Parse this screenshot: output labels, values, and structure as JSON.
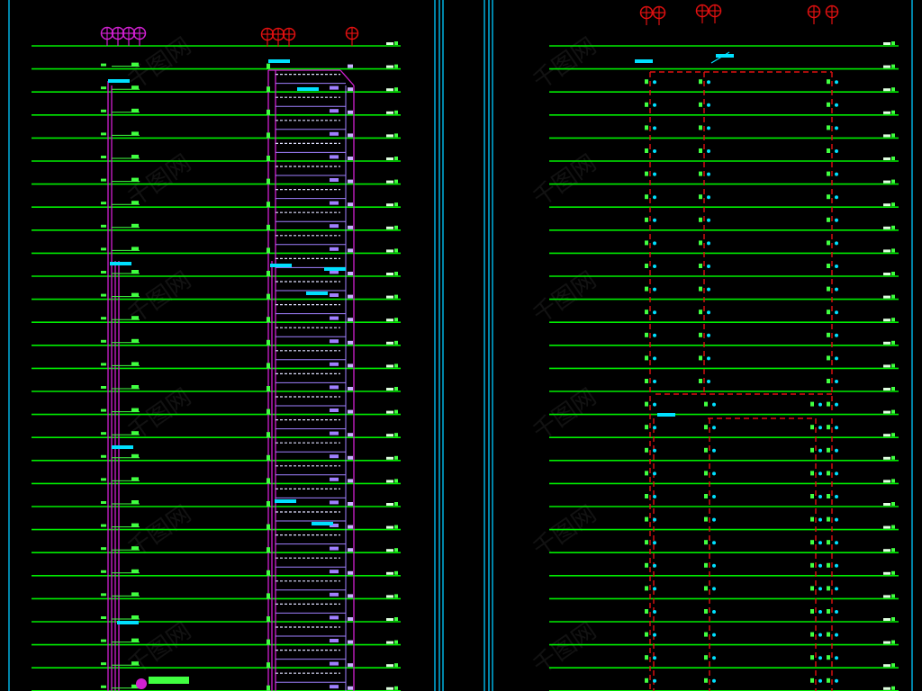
{
  "colors": {
    "background": "#000000",
    "floor_line": "#00ee00",
    "frame": "#00b0e0",
    "riser_left": "#d020d0",
    "riser_right": "#e01010",
    "branch": "#a080ff",
    "annotation": "#00e0ff",
    "tag": "#40ff40"
  },
  "icons": {
    "left_top_fixtures": "sprinkler-head-icon",
    "right_top_fixtures": "sprinkler-head-icon"
  },
  "watermark": {
    "text": "千图网"
  },
  "left_panel": {
    "floor_count": 28
  },
  "right_panel": {
    "floor_count": 28
  }
}
